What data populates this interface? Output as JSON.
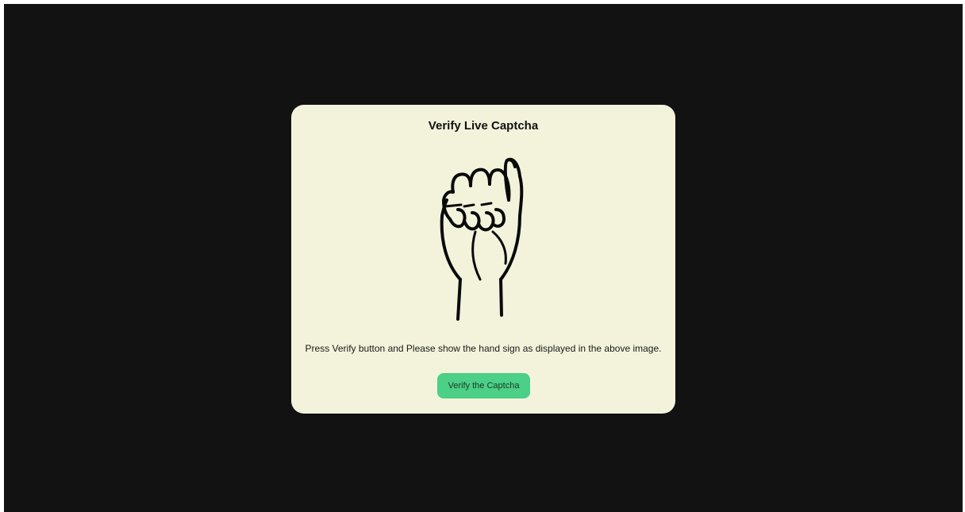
{
  "captcha": {
    "title": "Verify Live Captcha",
    "image_icon": "fist-hand-sign-icon",
    "instructions": "Press Verify button and Please show the hand sign as displayed in the above image.",
    "verify_label": "Verify the Captcha"
  },
  "colors": {
    "background": "#121212",
    "card": "#f3f3dc",
    "button": "#4ccf86"
  }
}
